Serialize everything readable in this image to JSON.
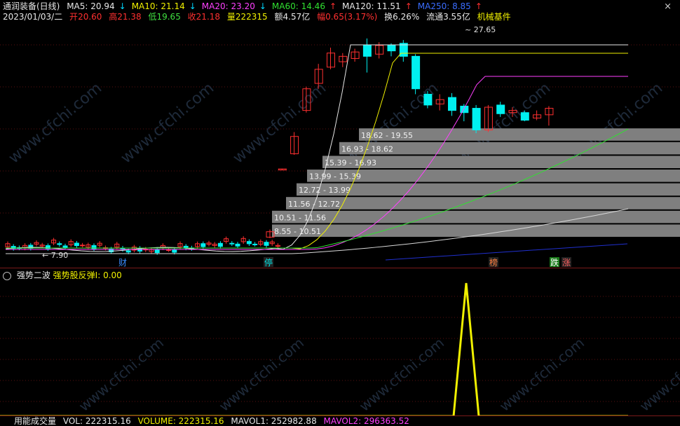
{
  "header": {
    "stock_name": "通润装备(日线)",
    "ma": [
      {
        "label": "MA5: 20.94",
        "arrow": "↓",
        "dir": "dn",
        "cls": "w"
      },
      {
        "label": "MA10: 21.14",
        "arrow": "↓",
        "dir": "dn",
        "cls": "y"
      },
      {
        "label": "MA20: 23.20",
        "arrow": "↓",
        "dir": "dn",
        "cls": "m"
      },
      {
        "label": "MA60: 14.46",
        "arrow": "↑",
        "dir": "up",
        "cls": "g"
      },
      {
        "label": "MA120: 11.51",
        "arrow": "↑",
        "dir": "up",
        "cls": "w"
      },
      {
        "label": "MA250: 8.85",
        "arrow": "↑",
        "dir": "up",
        "cls": "b"
      }
    ],
    "date": "2023/01/03/二",
    "open_label": "开",
    "open": "20.60",
    "high_label": "高",
    "high": "21.38",
    "low_label": "低",
    "low": "19.65",
    "close_label": "收",
    "close": "21.18",
    "vol_label": "量",
    "vol": "222315",
    "amt_label": "额",
    "amt": "4.57亿",
    "chg_label": "幅",
    "chg": "0.65(3.17%)",
    "turnover": "换6.26%",
    "float": "流通3.55亿",
    "sector": "机械基件"
  },
  "close_icon": "×",
  "main_chart": {
    "type": "candlestick",
    "peak_label": "27.65",
    "low_label": "7.90",
    "low_pointer": "←",
    "price_range": [
      7.0,
      29.0
    ],
    "volume_profile": [
      {
        "range": "8.55 - 10.51"
      },
      {
        "range": "10.51 - 11.56"
      },
      {
        "range": "11.56 - 12.72"
      },
      {
        "range": "12.72 - 13.99"
      },
      {
        "range": "13.99 - 15.39"
      },
      {
        "range": "15.39 - 16.93"
      },
      {
        "range": "16.93 - 18.62"
      },
      {
        "range": "18.62 - 19.55"
      }
    ],
    "markers": [
      {
        "text": "财",
        "color": "#3a8dff",
        "bg": "#000",
        "name": "marker-cai"
      },
      {
        "text": "停",
        "color": "#00e0e0",
        "bg": "#222",
        "name": "marker-ting"
      },
      {
        "text": "榜",
        "color": "#ff8040",
        "bg": "#222",
        "name": "marker-bang"
      },
      {
        "text": "跌",
        "color": "#ffffff",
        "bg": "#1a7a1a",
        "name": "marker-die"
      },
      {
        "text": "涨",
        "color": "#ff6060",
        "bg": "#222",
        "name": "marker-zhang"
      }
    ]
  },
  "sub_chart": {
    "title": "强势二波",
    "indicator": "强势股反弹I: 0.00",
    "type": "line",
    "series_values": [
      0,
      1,
      0
    ],
    "spike_position": "right"
  },
  "footer": {
    "indicator_name": "用能成交量",
    "vol": "VOL: 222315.16",
    "volume": "VOLUME: 222315.16",
    "mavol1": "MAVOL1: 252982.88",
    "mavol2": "MAVOL2: 296363.52"
  },
  "colors": {
    "up": "#ff3030",
    "down": "#00f0f0",
    "ma5": "#e8e8e8",
    "ma10": "#f0f000",
    "ma20": "#ff40ff",
    "ma60": "#30e030",
    "ma120": "#d8d8d8",
    "ma250": "#2030d0",
    "profile_bar": "#7f7f7f",
    "watermark": "#1e2a3a"
  }
}
